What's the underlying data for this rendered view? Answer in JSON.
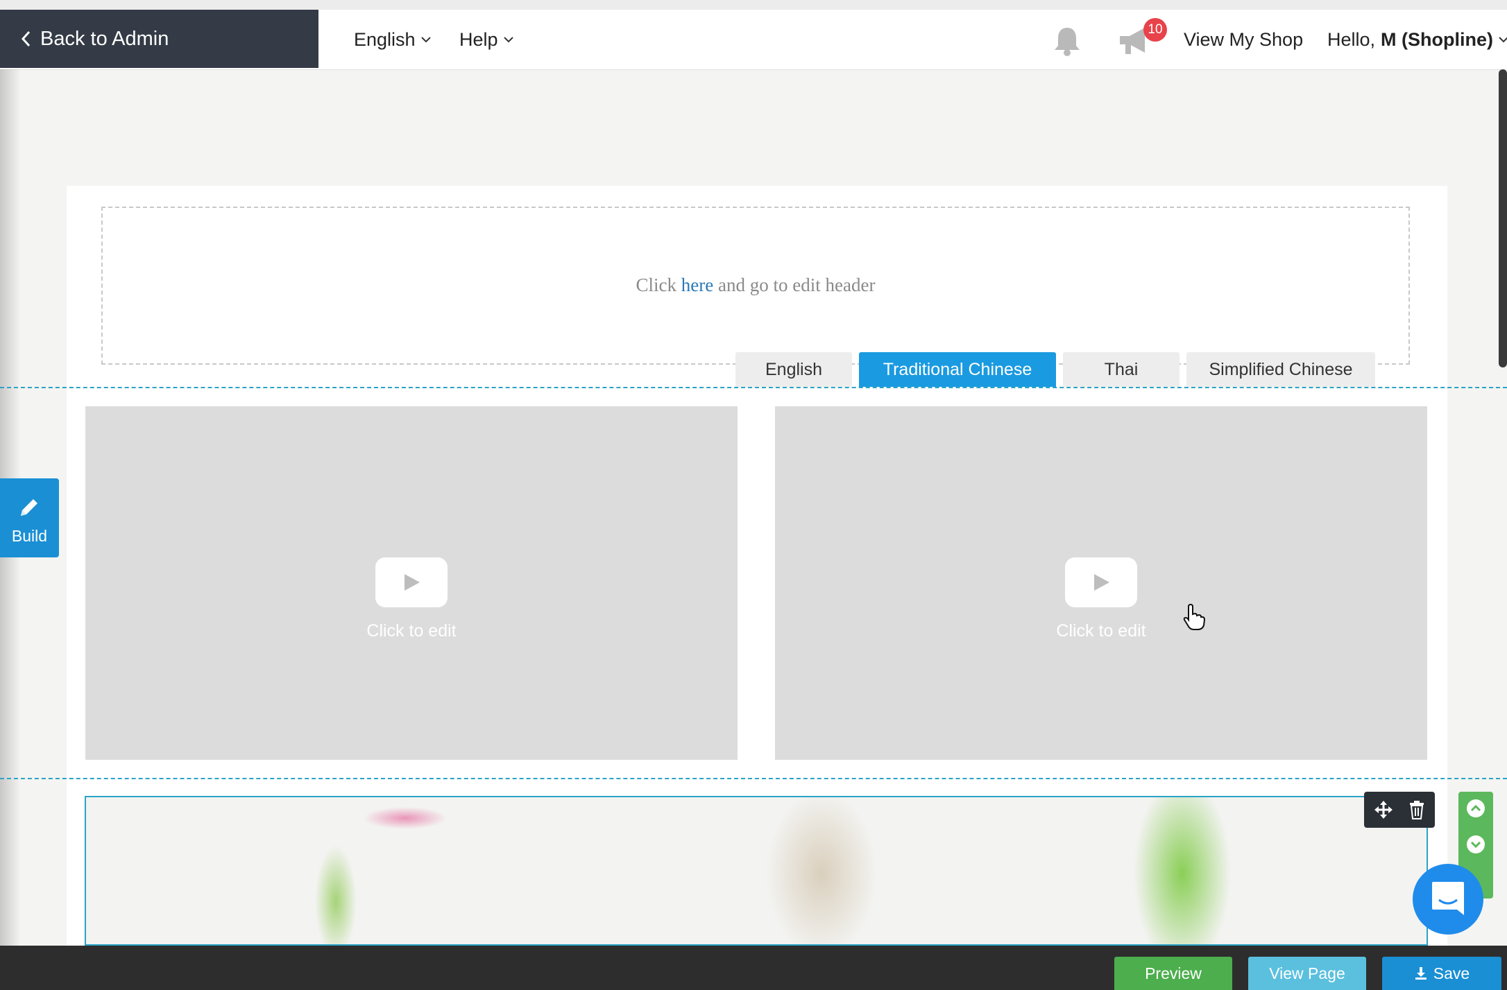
{
  "topbar": {
    "back_label": "Back to Admin",
    "language_label": "English",
    "help_label": "Help",
    "notification_count": "10",
    "view_shop_label": "View My Shop",
    "greeting": "Hello,",
    "user_name": "M (Shopline)"
  },
  "header_placeholder": {
    "before": "Click",
    "link": "here",
    "after": "and go to edit header"
  },
  "language_tabs": [
    {
      "label": "English",
      "active": false
    },
    {
      "label": "Traditional Chinese",
      "active": true
    },
    {
      "label": "Thai",
      "active": false
    },
    {
      "label": "Simplified Chinese",
      "active": false
    }
  ],
  "videos": [
    {
      "label": "Click to edit"
    },
    {
      "label": "Click to edit"
    }
  ],
  "build_label": "Build",
  "bottombar": {
    "preview_label": "Preview",
    "view_page_label": "View Page",
    "save_label": "Save"
  },
  "colors": {
    "admin_bar": "#343b46",
    "tab_active": "#1a9ae0",
    "build_button": "#1a8fd4",
    "preview_button": "#4cae4c",
    "view_page_button": "#5bc0de",
    "save_button": "#1a8fd4",
    "badge": "#e8424a",
    "guide_lines": "#2aa3c8"
  },
  "icons": [
    "chevron-left-icon",
    "chevron-down-icon",
    "bell-icon",
    "megaphone-icon",
    "pencil-icon",
    "youtube-play-icon",
    "move-icon",
    "trash-icon",
    "chevron-up-circle-icon",
    "chevron-down-circle-icon",
    "chat-icon",
    "download-icon"
  ]
}
